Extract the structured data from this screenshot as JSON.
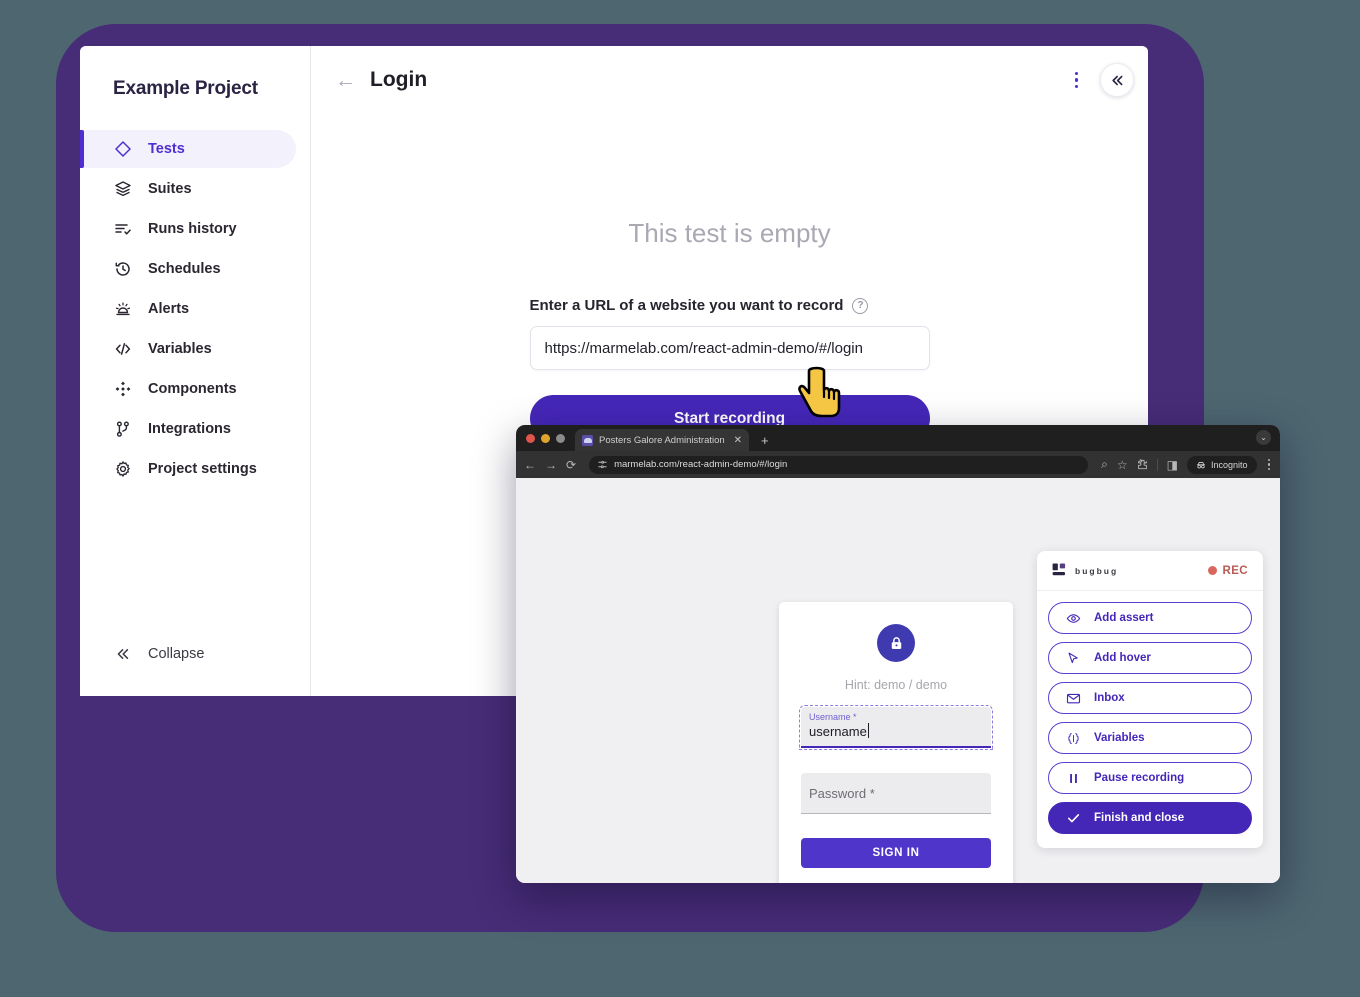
{
  "app": {
    "project_title": "Example Project",
    "sidebar": {
      "items": [
        {
          "label": "Tests",
          "icon": "diamond-icon",
          "active": true
        },
        {
          "label": "Suites",
          "icon": "layers-icon",
          "active": false
        },
        {
          "label": "Runs history",
          "icon": "list-check-icon",
          "active": false
        },
        {
          "label": "Schedules",
          "icon": "clock-history-icon",
          "active": false
        },
        {
          "label": "Alerts",
          "icon": "alarm-icon",
          "active": false
        },
        {
          "label": "Variables",
          "icon": "code-icon",
          "active": false
        },
        {
          "label": "Components",
          "icon": "cluster-icon",
          "active": false
        },
        {
          "label": "Integrations",
          "icon": "fork-icon",
          "active": false
        },
        {
          "label": "Project settings",
          "icon": "gear-icon",
          "active": false
        }
      ],
      "collapse_label": "Collapse",
      "collapse_icon": "chevron-double-left-icon"
    },
    "header": {
      "back_icon": "arrow-left-icon",
      "title": "Login",
      "menu_icon": "kebab-menu-icon",
      "collapse_icon": "chevron-double-left-icon"
    },
    "empty_state": {
      "title": "This test is empty",
      "url_label": "Enter a URL of a website you want to record",
      "help_icon": "question-circle-icon",
      "help_glyph": "?",
      "url_value": "https://marmelab.com/react-admin-demo/#/login",
      "url_placeholder": "https://",
      "start_button": "Start recording"
    }
  },
  "browser": {
    "tab": {
      "title": "Posters Galore Administration",
      "close_icon": "close-icon",
      "close_glyph": "✕",
      "new_tab_glyph": "+"
    },
    "window_chevron_glyph": "⌄",
    "toolbar": {
      "back_glyph": "←",
      "forward_glyph": "→",
      "reload_glyph": "⟳",
      "url": "marmelab.com/react-admin-demo/#/login",
      "zoom_glyph": "⌕",
      "bookmark_glyph": "☆",
      "extensions_glyph": "⬠",
      "split_glyph": "◨",
      "incognito_label": "Incognito"
    }
  },
  "login_page": {
    "lock_icon": "lock-icon",
    "hint": "Hint: demo / demo",
    "username": {
      "label": "Username *",
      "value": "username",
      "placeholder": "Username *"
    },
    "password": {
      "label": "Password *",
      "value": "",
      "placeholder": "Password *"
    },
    "submit_label": "SIGN IN"
  },
  "recorder": {
    "brand": "bugbug",
    "rec_label": "REC",
    "buttons": [
      {
        "label": "Add assert",
        "icon": "eye-icon",
        "primary": false
      },
      {
        "label": "Add hover",
        "icon": "cursor-icon",
        "primary": false
      },
      {
        "label": "Inbox",
        "icon": "envelope-icon",
        "primary": false
      },
      {
        "label": "Variables",
        "icon": "braces-icon",
        "primary": false
      },
      {
        "label": "Pause recording",
        "icon": "pause-icon",
        "primary": false
      },
      {
        "label": "Finish and close",
        "icon": "check-icon",
        "primary": true
      }
    ]
  },
  "colors": {
    "brand_purple": "#4527b8",
    "accent_purple": "#4f2fd0",
    "backdrop_purple": "#472c77",
    "page_background": "#4d6670",
    "rec_red": "#d9675f"
  }
}
